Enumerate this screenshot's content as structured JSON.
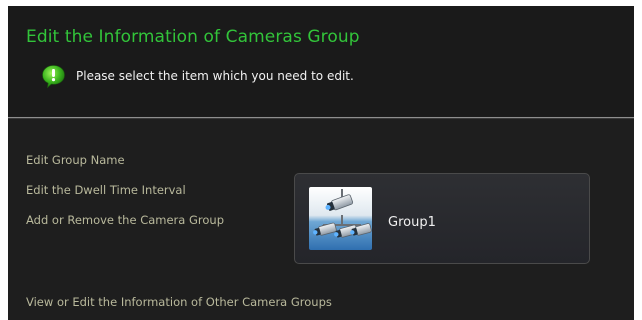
{
  "header": {
    "title": "Edit the Information of Cameras Group",
    "hint": "Please select the item which you need to edit."
  },
  "menu": {
    "items": [
      "Edit Group Name",
      "Edit the Dwell Time Interval",
      "Add or Remove the Camera Group"
    ],
    "other_groups": "View or Edit the Information of Other Camera Groups"
  },
  "group_card": {
    "label": "Group1",
    "icon": "camera-group-icon"
  },
  "colors": {
    "title": "#32c43a",
    "link": "#b9b99c",
    "background": "#1c1c1c"
  }
}
